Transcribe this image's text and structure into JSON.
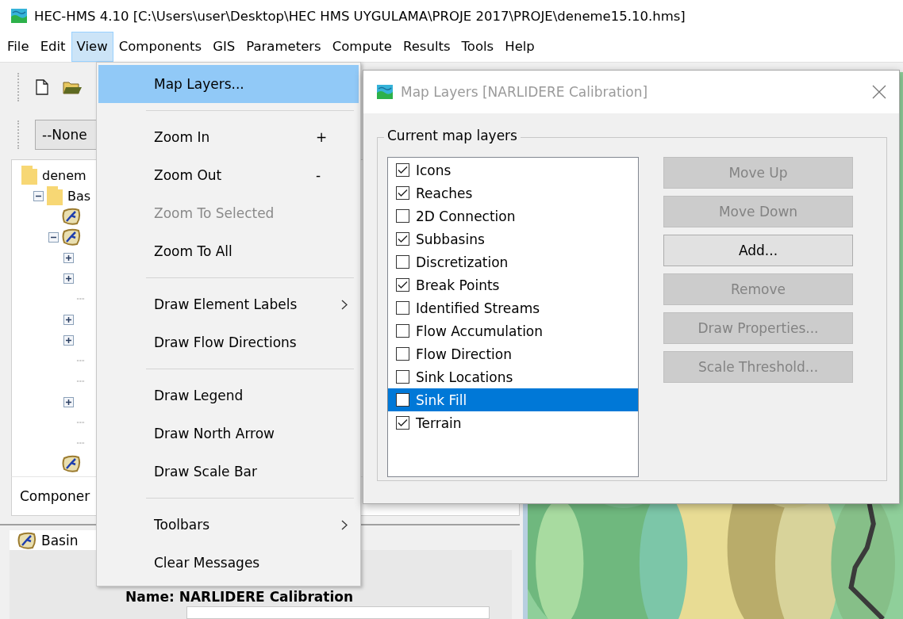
{
  "window": {
    "title": "HEC-HMS 4.10 [C:\\Users\\user\\Desktop\\HEC HMS UYGULAMA\\PROJE 2017\\PROJE\\deneme15.10.hms]"
  },
  "menubar": [
    {
      "label": "File",
      "selected": false
    },
    {
      "label": "Edit",
      "selected": false
    },
    {
      "label": "View",
      "selected": true
    },
    {
      "label": "Components",
      "selected": false
    },
    {
      "label": "GIS",
      "selected": false
    },
    {
      "label": "Parameters",
      "selected": false
    },
    {
      "label": "Compute",
      "selected": false
    },
    {
      "label": "Results",
      "selected": false
    },
    {
      "label": "Tools",
      "selected": false
    },
    {
      "label": "Help",
      "selected": false
    }
  ],
  "toolbar": {
    "combo": "--None"
  },
  "tree": [
    {
      "kind": "folder",
      "label": "denem",
      "children": [
        {
          "kind": "folder",
          "label": "Bas",
          "expanded": true,
          "children": [
            {
              "kind": "basin"
            },
            {
              "kind": "basin",
              "expanded": true,
              "children": [
                {
                  "expanded": false
                },
                {
                  "expanded": false
                },
                {
                  "kind": "leaf"
                },
                {
                  "expanded": false
                },
                {
                  "expanded": false
                },
                {
                  "kind": "leaf"
                },
                {
                  "kind": "leaf"
                },
                {
                  "expanded": false
                },
                {
                  "kind": "leaf"
                },
                {
                  "kind": "leaf"
                }
              ]
            },
            {
              "kind": "basin"
            }
          ]
        }
      ]
    }
  ],
  "components_tab": "Componer",
  "basin_panel": {
    "tab": "Basin",
    "name_label": "Name: NARLIDERE Calibration"
  },
  "view_menu": {
    "items": [
      {
        "kind": "item",
        "label": "Map Layers...",
        "selected": true,
        "disabled": false
      },
      {
        "kind": "separator"
      },
      {
        "kind": "item",
        "label": "Zoom In",
        "shortcut": "+",
        "selected": false,
        "disabled": false
      },
      {
        "kind": "item",
        "label": "Zoom Out",
        "shortcut": "-",
        "selected": false,
        "disabled": false
      },
      {
        "kind": "item",
        "label": "Zoom To Selected",
        "selected": false,
        "disabled": true
      },
      {
        "kind": "item",
        "label": "Zoom To All",
        "selected": false,
        "disabled": false
      },
      {
        "kind": "separator"
      },
      {
        "kind": "item",
        "label": "Draw Element Labels",
        "submenu": true,
        "selected": false,
        "disabled": false
      },
      {
        "kind": "item",
        "label": "Draw Flow Directions",
        "selected": false,
        "disabled": false
      },
      {
        "kind": "separator"
      },
      {
        "kind": "item",
        "label": "Draw Legend",
        "selected": false,
        "disabled": false
      },
      {
        "kind": "item",
        "label": "Draw North Arrow",
        "selected": false,
        "disabled": false
      },
      {
        "kind": "item",
        "label": "Draw Scale Bar",
        "selected": false,
        "disabled": false
      },
      {
        "kind": "separator"
      },
      {
        "kind": "item",
        "label": "Toolbars",
        "submenu": true,
        "selected": false,
        "disabled": false
      },
      {
        "kind": "item",
        "label": "Clear Messages",
        "selected": false,
        "disabled": false
      }
    ]
  },
  "dialog": {
    "title": "Map Layers [NARLIDERE Calibration]",
    "group_title": "Current map layers",
    "layers": [
      {
        "label": "Icons",
        "checked": true,
        "selected": false
      },
      {
        "label": "Reaches",
        "checked": true,
        "selected": false
      },
      {
        "label": "2D Connection",
        "checked": false,
        "selected": false
      },
      {
        "label": "Subbasins",
        "checked": true,
        "selected": false
      },
      {
        "label": "Discretization",
        "checked": false,
        "selected": false
      },
      {
        "label": "Break Points",
        "checked": true,
        "selected": false
      },
      {
        "label": "Identified Streams",
        "checked": false,
        "selected": false
      },
      {
        "label": "Flow Accumulation",
        "checked": false,
        "selected": false
      },
      {
        "label": "Flow Direction",
        "checked": false,
        "selected": false
      },
      {
        "label": "Sink Locations",
        "checked": false,
        "selected": false
      },
      {
        "label": "Sink Fill",
        "checked": false,
        "selected": true
      },
      {
        "label": "Terrain",
        "checked": true,
        "selected": false
      }
    ],
    "buttons": [
      {
        "label": "Move Up",
        "disabled": true
      },
      {
        "label": "Move Down",
        "disabled": true
      },
      {
        "label": "Add...",
        "disabled": false
      },
      {
        "label": "Remove",
        "disabled": true
      },
      {
        "label": "Draw Properties...",
        "disabled": true
      },
      {
        "label": "Scale Threshold...",
        "disabled": true
      }
    ]
  }
}
